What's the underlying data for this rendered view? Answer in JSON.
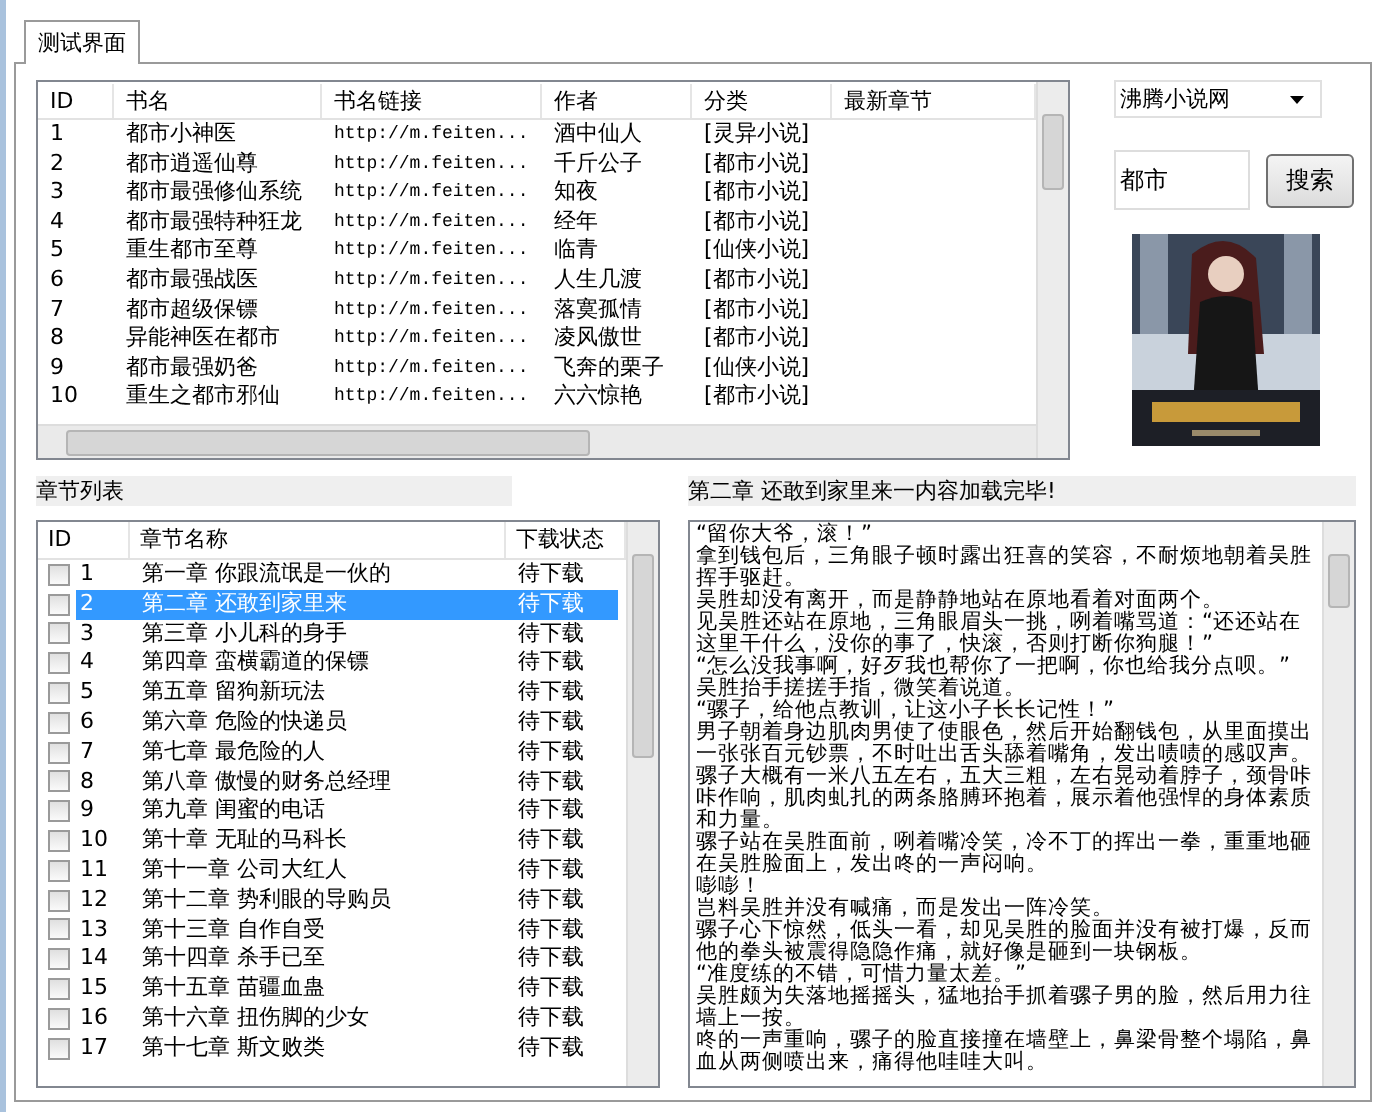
{
  "tabs": [
    {
      "label": "测试界面",
      "selected": true
    }
  ],
  "book_table": {
    "columns": [
      "ID",
      "书名",
      "书名链接",
      "作者",
      "分类",
      "最新章节"
    ],
    "rows": [
      [
        "1",
        "都市小神医",
        "http://m.feiten...",
        "酒中仙人",
        "[灵异小说]",
        ""
      ],
      [
        "2",
        "都市逍遥仙尊",
        "http://m.feiten...",
        "千斤公子",
        "[都市小说]",
        ""
      ],
      [
        "3",
        "都市最强修仙系统",
        "http://m.feiten...",
        "知夜",
        "[都市小说]",
        ""
      ],
      [
        "4",
        "都市最强特种狂龙",
        "http://m.feiten...",
        "经年",
        "[都市小说]",
        ""
      ],
      [
        "5",
        "重生都市至尊",
        "http://m.feiten...",
        "临青",
        "[仙侠小说]",
        ""
      ],
      [
        "6",
        "都市最强战医",
        "http://m.feiten...",
        "人生几渡",
        "[都市小说]",
        ""
      ],
      [
        "7",
        "都市超级保镖",
        "http://m.feiten...",
        "落寞孤情",
        "[都市小说]",
        ""
      ],
      [
        "8",
        "异能神医在都市",
        "http://m.feiten...",
        "凌风傲世",
        "[都市小说]",
        ""
      ],
      [
        "9",
        "都市最强奶爸",
        "http://m.feiten...",
        "飞奔的栗子",
        "[仙侠小说]",
        ""
      ],
      [
        "10",
        "重生之都市邪仙",
        "http://m.feiten...",
        "六六惊艳",
        "[都市小说]",
        ""
      ]
    ]
  },
  "source_dropdown": {
    "value": "沸腾小说网"
  },
  "search": {
    "value": "都市",
    "button": "搜索"
  },
  "chapter_list": {
    "title": "章节列表",
    "columns": [
      "ID",
      "章节名称",
      "下载状态"
    ],
    "rows": [
      {
        "id": "1",
        "name": "第一章  你跟流氓是一伙的",
        "status": "待下载",
        "checked": false,
        "selected": false
      },
      {
        "id": "2",
        "name": "第二章  还敢到家里来",
        "status": "待下载",
        "checked": false,
        "selected": true
      },
      {
        "id": "3",
        "name": "第三章  小儿科的身手",
        "status": "待下载",
        "checked": false,
        "selected": false
      },
      {
        "id": "4",
        "name": "第四章  蛮横霸道的保镖",
        "status": "待下载",
        "checked": false,
        "selected": false
      },
      {
        "id": "5",
        "name": "第五章  留狗新玩法",
        "status": "待下载",
        "checked": false,
        "selected": false
      },
      {
        "id": "6",
        "name": "第六章  危险的快递员",
        "status": "待下载",
        "checked": false,
        "selected": false
      },
      {
        "id": "7",
        "name": "第七章  最危险的人",
        "status": "待下载",
        "checked": false,
        "selected": false
      },
      {
        "id": "8",
        "name": "第八章  傲慢的财务总经理",
        "status": "待下载",
        "checked": false,
        "selected": false
      },
      {
        "id": "9",
        "name": "第九章  闺蜜的电话",
        "status": "待下载",
        "checked": false,
        "selected": false
      },
      {
        "id": "10",
        "name": "第十章  无耻的马科长",
        "status": "待下载",
        "checked": false,
        "selected": false
      },
      {
        "id": "11",
        "name": "第十一章  公司大红人",
        "status": "待下载",
        "checked": false,
        "selected": false
      },
      {
        "id": "12",
        "name": "第十二章  势利眼的导购员",
        "status": "待下载",
        "checked": false,
        "selected": false
      },
      {
        "id": "13",
        "name": "第十三章  自作自受",
        "status": "待下载",
        "checked": false,
        "selected": false
      },
      {
        "id": "14",
        "name": "第十四章  杀手已至",
        "status": "待下载",
        "checked": false,
        "selected": false
      },
      {
        "id": "15",
        "name": "第十五章  苗疆血蛊",
        "status": "待下载",
        "checked": false,
        "selected": false
      },
      {
        "id": "16",
        "name": "第十六章  扭伤脚的少女",
        "status": "待下载",
        "checked": false,
        "selected": false
      },
      {
        "id": "17",
        "name": "第十七章  斯文败类",
        "status": "待下载",
        "checked": false,
        "selected": false
      }
    ]
  },
  "content": {
    "status": "第二章 还敢到家里来一内容加载完毕!",
    "paragraphs": [
      "“留你大爷，滚！”",
      "拿到钱包后，三角眼子顿时露出狂喜的笑容，不耐烦地朝着吴胜挥手驱赶。",
      "吴胜却没有离开，而是静静地站在原地看着对面两个。",
      "见吴胜还站在原地，三角眼眉头一挑，咧着嘴骂道：“还还站在这里干什么，没你的事了，快滚，否则打断你狗腿！”",
      "“怎么没我事啊，好歹我也帮你了一把啊，你也给我分点呗。”",
      "吴胜抬手搓搓手指，微笑着说道。",
      "“骡子，给他点教训，让这小子长长记性！”",
      "男子朝着身边肌肉男使了使眼色，然后开始翻钱包，从里面摸出一张张百元钞票，不时吐出舌头舔着嘴角，发出啧啧的感叹声。",
      "骡子大概有一米八五左右，五大三粗，左右晃动着脖子，颈骨咔咔作响，肌肉虬扎的两条胳膊环抱着，展示着他强悍的身体素质和力量。",
      "骡子站在吴胜面前，咧着嘴冷笑，冷不丁的挥出一拳，重重地砸在吴胜脸面上，发出咚的一声闷响。",
      "嘭嘭！",
      "岂料吴胜并没有喊痛，而是发出一阵冷笑。",
      "骡子心下惊然，低头一看，却见吴胜的脸面并没有被打爆，反而他的拳头被震得隐隐作痛，就好像是砸到一块钢板。",
      "“准度练的不错，可惜力量太差。”",
      "吴胜颇为失落地摇摇头，猛地抬手抓着骡子男的脸，然后用力往墙上一按。",
      "咚的一声重响，骡子的脸直接撞在墙壁上，鼻梁骨整个塌陷，鼻血从两侧喷出来，痛得他哇哇大叫。"
    ]
  }
}
